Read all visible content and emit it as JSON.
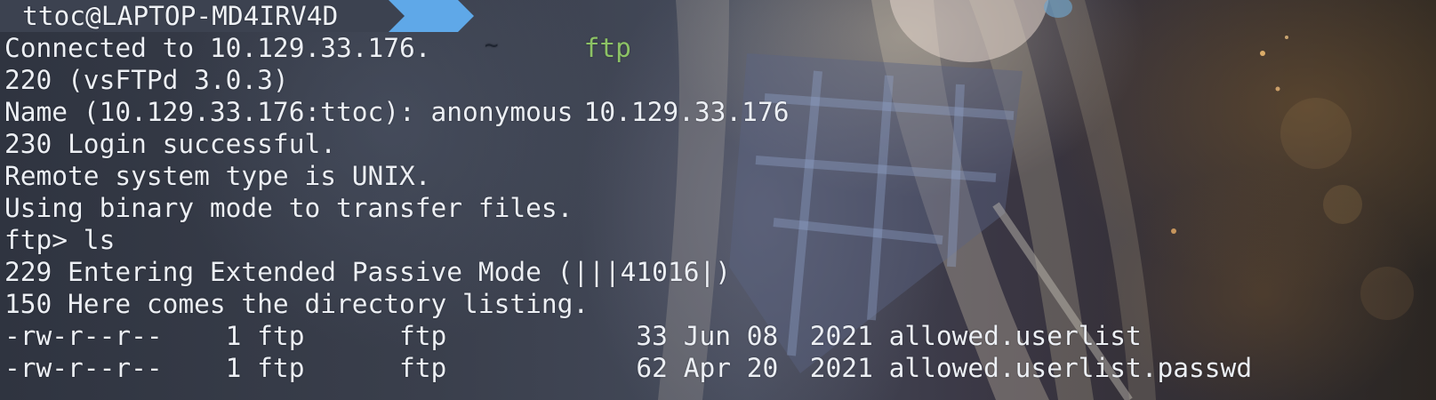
{
  "prompt": {
    "user_host": "ttoc@LAPTOP-MD4IRV4D",
    "directory": "~",
    "command": "ftp",
    "arguments": "10.129.33.176"
  },
  "output": [
    "Connected to 10.129.33.176.",
    "220 (vsFTPd 3.0.3)",
    "Name (10.129.33.176:ttoc): anonymous",
    "230 Login successful.",
    "Remote system type is UNIX.",
    "Using binary mode to transfer files.",
    "ftp> ls",
    "229 Entering Extended Passive Mode (|||41016|)",
    "150 Here comes the directory listing.",
    "-rw-r--r--    1 ftp      ftp            33 Jun 08  2021 allowed.userlist",
    "-rw-r--r--    1 ftp      ftp            62 Apr 20  2021 allowed.userlist.passwd"
  ],
  "colors": {
    "prompt_user_bg": "#3c4250",
    "prompt_dir_bg": "#5fa8e8",
    "command_green": "#8cc265",
    "text": "#eceff4"
  }
}
